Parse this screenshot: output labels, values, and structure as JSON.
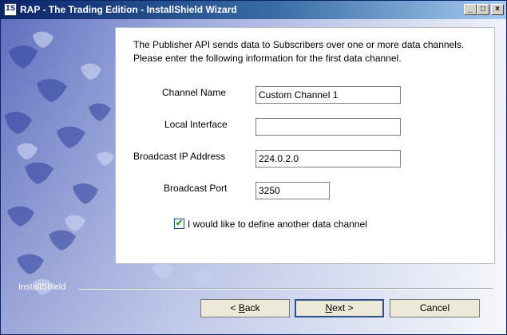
{
  "window": {
    "title": "RAP - The Trading Edition - InstallShield Wizard",
    "icon_text": "IS",
    "controls": {
      "minimize": "_",
      "maximize": "□",
      "close": "×"
    }
  },
  "description": {
    "line1": "The Publisher API sends data to Subscribers over one or more data channels.",
    "line2": "Please enter the following information for the first data channel."
  },
  "form": {
    "channel_name": {
      "label": "Channel Name",
      "value": "Custom Channel 1"
    },
    "local_interface": {
      "label": "Local Interface",
      "value": ""
    },
    "broadcast_ip": {
      "label": "Broadcast IP Address",
      "value": "224.0.2.0"
    },
    "broadcast_port": {
      "label": "Broadcast Port",
      "value": "3250"
    },
    "another_channel": {
      "label": "I would like to define another data channel",
      "checked": true,
      "mark": "✔"
    }
  },
  "footer": {
    "brand": "InstallShield",
    "back": {
      "prefix": "< ",
      "mnemonic": "B",
      "rest": "ack"
    },
    "next": {
      "mnemonic": "N",
      "rest": "ext >"
    },
    "cancel": "Cancel"
  },
  "colors": {
    "title_start": "#0a246a",
    "title_end": "#a6caf0",
    "background": "#e0e6f3",
    "art_accent": "#7d8fd4"
  }
}
